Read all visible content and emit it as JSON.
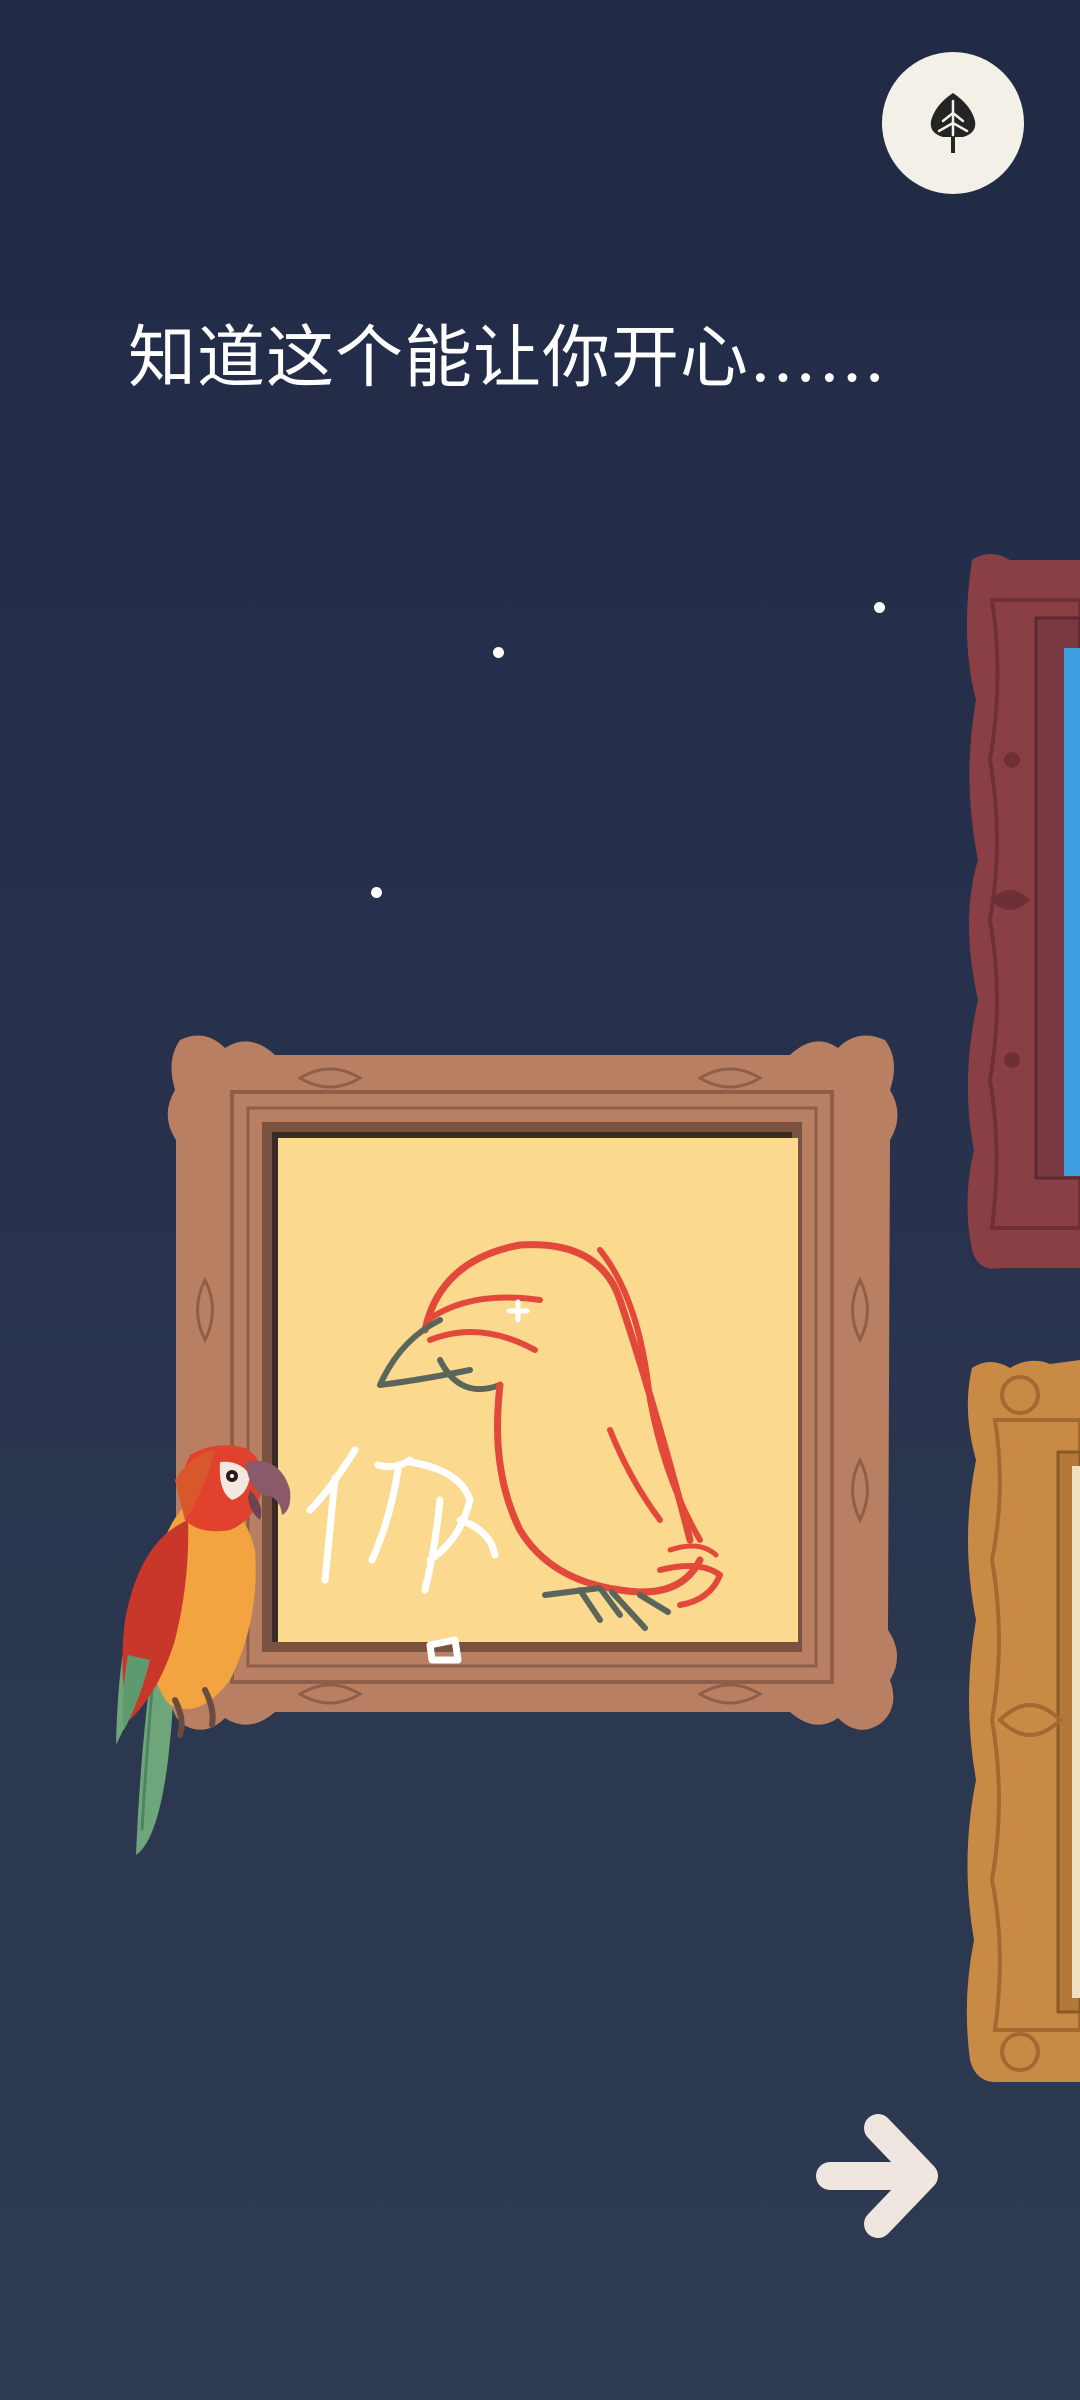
{
  "dialogue": {
    "text": "知道这个能让你开心……"
  },
  "menu_button": {
    "icon": "leaf-icon"
  },
  "next_button": {
    "icon": "arrow-right-icon"
  },
  "scene": {
    "main_painting": {
      "drawing": "parrot-doodle",
      "scribble": "你"
    },
    "side_paintings": [
      "red-frame-painting",
      "gold-frame-painting"
    ],
    "character": "parrot"
  },
  "colors": {
    "background_top": "#212a45",
    "background_bottom": "#2e3a52",
    "canvas": "#fbd98f",
    "frame_main": "#b87f63",
    "frame_red": "#8a3f45",
    "frame_gold": "#c98a45",
    "doodle_red": "#e2493a",
    "doodle_gray": "#5b665a",
    "button_light": "#f3f1e7",
    "arrow": "#f0e6e0"
  }
}
